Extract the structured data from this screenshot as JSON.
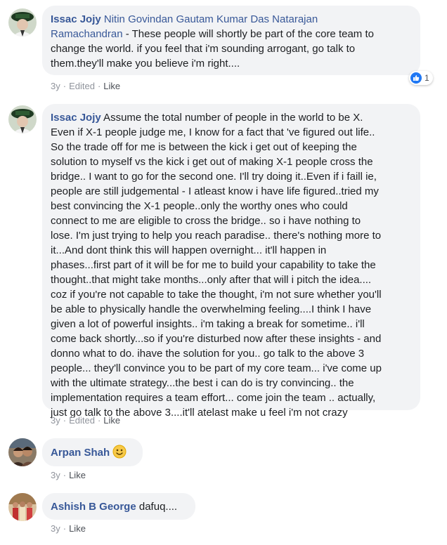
{
  "comments": [
    {
      "author": "Issac Jojy",
      "tags": "Nitin Govindan Gautam Kumar Das Natarajan",
      "tags_line2": "Ramachandran",
      "text_line1_rest": "",
      "text_line2_rest": " - These people will shortly be part of the core team to",
      "text_line3": "change the world. if you feel that i'm sounding arrogant, go talk to",
      "text_line4": "them.they'll make you believe i'm right....",
      "time": "3y",
      "edited": "Edited",
      "like": "Like",
      "reaction_count": "1",
      "reaction_icon": "thumbs-up-icon"
    },
    {
      "author": "Issac Jojy",
      "lines": [
        " Assume the total number of people in the world to be X.",
        "Even if X-1 people judge me, I know for a fact that 've figured out life..",
        "So the trade off for me is between the kick i get out of keeping the",
        "solution to myself vs the kick i get out of making X-1 people cross the",
        "bridge.. I want to go for the second one. I'll try doing it..Even if i faill ie,",
        "people are still judgemental - I atleast know i have life figured..tried my",
        "best convincing the X-1 people..only the worthy ones who could",
        "connect to me are eligible to cross the bridge.. so i have nothing to",
        "lose. I'm just trying to help you reach paradise.. there's nothing more to",
        "it...And dont think this will happen overnight... it'll happen in",
        "phases...first part of it will be for me to build your capability to take the",
        "thought..that might take months...only after that will i pitch the idea....",
        "coz if you're not capable to take the thought, i'm not sure whether you'll",
        "be able to physically handle the overwhelming feeling....I think I have",
        "given a lot of powerful insights.. i'm taking a break for sometime.. i'll",
        "come back shortly...so if you're disturbed now after these insights - and",
        "donno what to do. ihave the solution for you.. go talk to the above 3",
        "people... they'll convince you to be part of my core team... i've come up",
        "with the ultimate strategy...the best i can do is try convincing.. the",
        "implementation requires a team effort... come join the team .. actually,",
        "just go talk to the above 3....it'll atelast make u feel i'm not crazy"
      ],
      "time": "3y",
      "edited": "Edited",
      "like": "Like"
    },
    {
      "author": "Arpan Shah",
      "emoji_icon": "smiley-emoji-icon",
      "time": "3y",
      "like": "Like"
    },
    {
      "author": "Ashish B George",
      "text": " dafuq....",
      "time": "3y",
      "like": "Like"
    }
  ],
  "colors": {
    "link": "#385898",
    "bubble": "#f2f3f5",
    "meta": "#90949c",
    "like_blue": "#2078f4"
  }
}
